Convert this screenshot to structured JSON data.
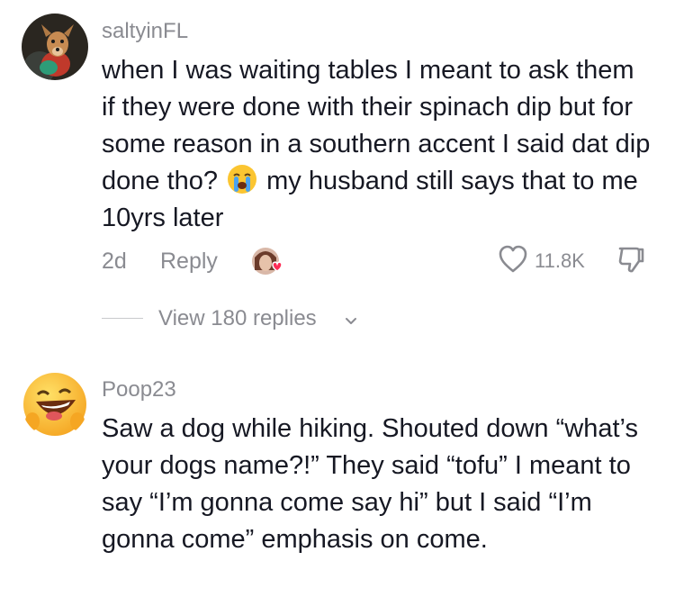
{
  "comments": [
    {
      "username": "saltyinFL",
      "text_before_emoji": "when I was waiting tables I meant to ask them if they were done with their spinach dip but for some reason in a southern accent I said dat dip done tho?",
      "emoji": "loudly-crying-face",
      "text_after_emoji": "my husband still says that to me 10yrs later",
      "time": "2d",
      "reply_label": "Reply",
      "likes": "11.8K",
      "view_replies": "View 180 replies"
    },
    {
      "username": "Poop23",
      "text": "Saw a dog while hiking. Shouted down “what’s your dogs name?!” They said “tofu” I meant to say “I’m gonna come say hi” but I said “I’m gonna come” emphasis on come."
    }
  ],
  "colors": {
    "text": "#161823",
    "muted": "#8a8b91",
    "heart_badge": "#fe2c55"
  }
}
